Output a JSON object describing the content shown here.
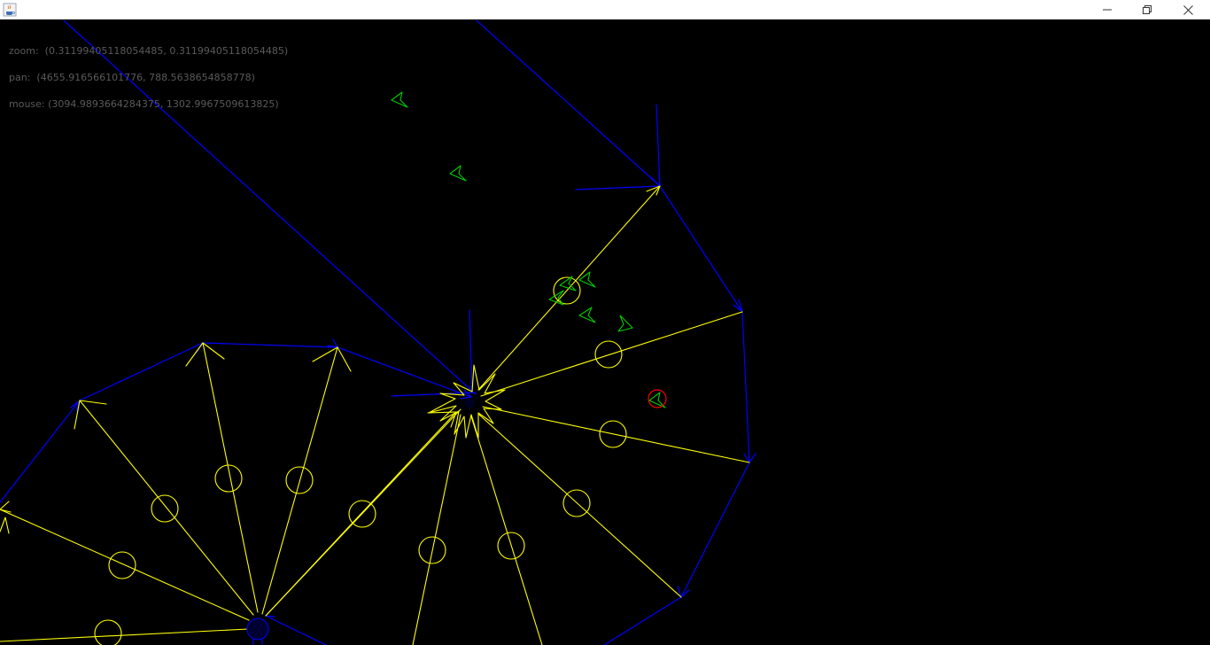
{
  "window": {
    "app_icon": "java-cup-icon",
    "controls": {
      "minimize_icon": "minimize-icon",
      "maximize_icon": "restore-icon",
      "close_icon": "close-icon"
    }
  },
  "hud": {
    "zoom_label": "zoom:",
    "zoom_value": "(0.31199405118054485, 0.31199405118054485)",
    "pan_label": "pan:",
    "pan_value": "(4655.916566101776, 788.5638654858778)",
    "mouse_label": "mouse:",
    "mouse_value": "(3094.9893664284375, 1302.9967509613825)"
  },
  "colors": {
    "background": "#000000",
    "graph_edge": "#0000ff",
    "tree_edge": "#ffff00",
    "agent": "#00cc00",
    "selected_agent_ring": "#ff0000",
    "hud_text": "#5a5a5a"
  },
  "scene": {
    "agent_count_visible": 8,
    "waypoint_count_visible": 15,
    "hub_count_visible": 2
  }
}
